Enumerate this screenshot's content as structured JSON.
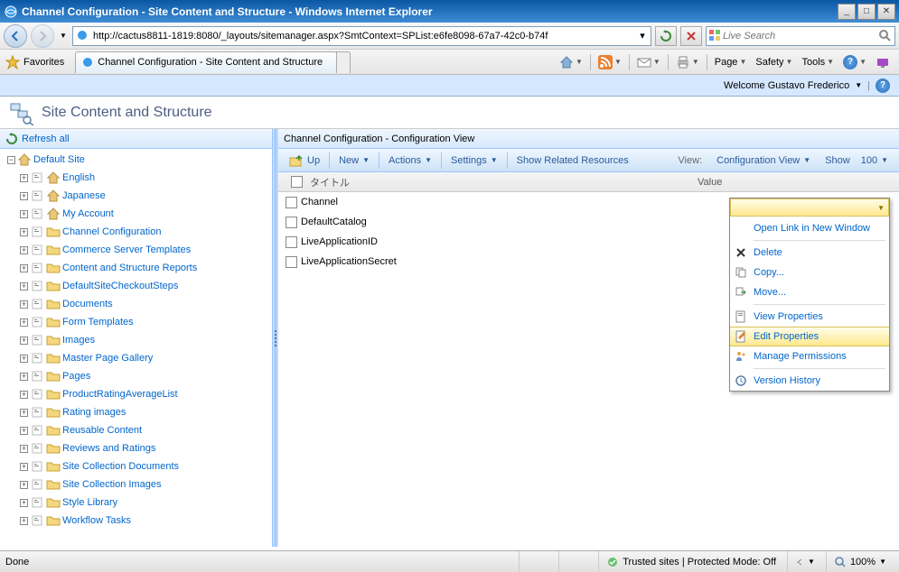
{
  "titlebar": {
    "text": "Channel Configuration - Site Content and Structure - Windows Internet Explorer"
  },
  "navbar": {
    "url": "http://cactus8811-1819:8080/_layouts/sitemanager.aspx?SmtContext=SPList:e6fe8098-67a7-42c0-b74f",
    "search_placeholder": "Live Search"
  },
  "cmdbar": {
    "favorites": "Favorites",
    "tab_title": "Channel Configuration - Site Content and Structure",
    "menu_page": "Page",
    "menu_safety": "Safety",
    "menu_tools": "Tools"
  },
  "userbar": {
    "welcome": "Welcome Gustavo Frederico "
  },
  "page": {
    "title": "Site Content and Structure"
  },
  "left": {
    "refresh": "Refresh all",
    "root": "Default Site",
    "sites": [
      "English",
      "Japanese",
      "My Account"
    ],
    "lists": [
      "Channel Configuration",
      "Commerce Server Templates",
      "Content and Structure Reports",
      "DefaultSiteCheckoutSteps",
      "Documents",
      "Form Templates",
      "Images",
      "Master Page Gallery",
      "Pages",
      "ProductRatingAverageList",
      "Rating images",
      "Reusable Content",
      "Reviews and Ratings",
      "Site Collection Documents",
      "Site Collection Images",
      "Style Library",
      "Workflow Tasks"
    ]
  },
  "right": {
    "breadcrumb": "Channel Configuration - Configuration View",
    "toolbar": {
      "up": "Up",
      "new": "New",
      "actions": "Actions",
      "settings": "Settings",
      "related": "Show Related Resources",
      "view_label": "View:",
      "view_name": "Configuration View",
      "show": "Show",
      "count": "100"
    },
    "columns": {
      "title": "タイトル",
      "value": "Value"
    },
    "items": [
      "Channel",
      "DefaultCatalog",
      "LiveApplicationID",
      "LiveApplicationSecret"
    ]
  },
  "ctx": {
    "open": "Open Link in New Window",
    "delete": "Delete",
    "copy": "Copy...",
    "move": "Move...",
    "viewprops": "View Properties",
    "editprops": "Edit Properties",
    "perms": "Manage Permissions",
    "version": "Version History"
  },
  "status": {
    "done": "Done",
    "zone": "Trusted sites | Protected Mode: Off",
    "zoom": "100%"
  }
}
